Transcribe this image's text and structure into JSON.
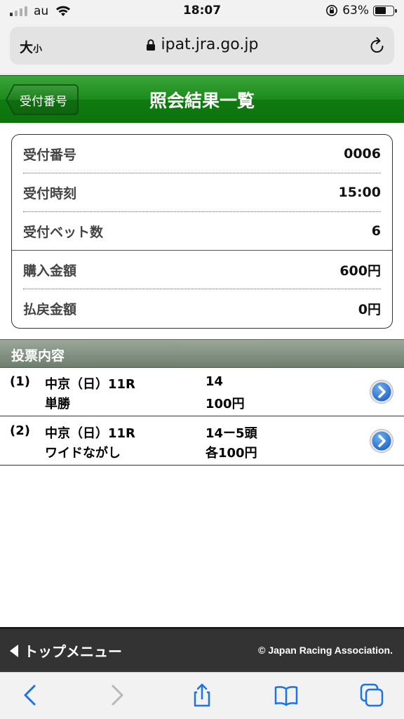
{
  "status_bar": {
    "carrier": "au",
    "time": "18:07",
    "battery_percent": "63%",
    "battery_level": 0.63,
    "signal_bars_on": 1,
    "signal_bars_total": 4
  },
  "browser": {
    "text_size_big": "大",
    "text_size_small": "小",
    "url": "ipat.jra.go.jp"
  },
  "header": {
    "back_label": "受付番号",
    "title": "照会結果一覧"
  },
  "summary": [
    {
      "label": "受付番号",
      "value": "0006"
    },
    {
      "label": "受付時刻",
      "value": "15:00"
    },
    {
      "label": "受付ベット数",
      "value": "6"
    },
    {
      "label": "購入金額",
      "value": "600円"
    },
    {
      "label": "払戻金額",
      "value": "0円"
    }
  ],
  "section_title": "投票内容",
  "bets": [
    {
      "no": "(1)",
      "race": "中京（日）11R",
      "type": "単勝",
      "horses": "14",
      "amount": "100円"
    },
    {
      "no": "(2)",
      "race": "中京（日）11R",
      "type": "ワイドながし",
      "horses": "14ー5頭",
      "amount": "各100円"
    }
  ],
  "footer": {
    "top_menu": "トップメニュー",
    "copyright": "© Japan Racing Association."
  },
  "colors": {
    "header_green": "#1c8a1c",
    "section_gray": "#7f8f7f",
    "toolbar_blue": "#1a73e8",
    "footer_bg": "#333333"
  },
  "icons": [
    "wifi-icon",
    "rotation-lock-icon",
    "battery-icon",
    "padlock-icon",
    "reload-icon",
    "chevron-right-circle-icon",
    "back-chevron-icon",
    "forward-chevron-icon",
    "share-icon",
    "bookmarks-icon",
    "tabs-icon"
  ]
}
